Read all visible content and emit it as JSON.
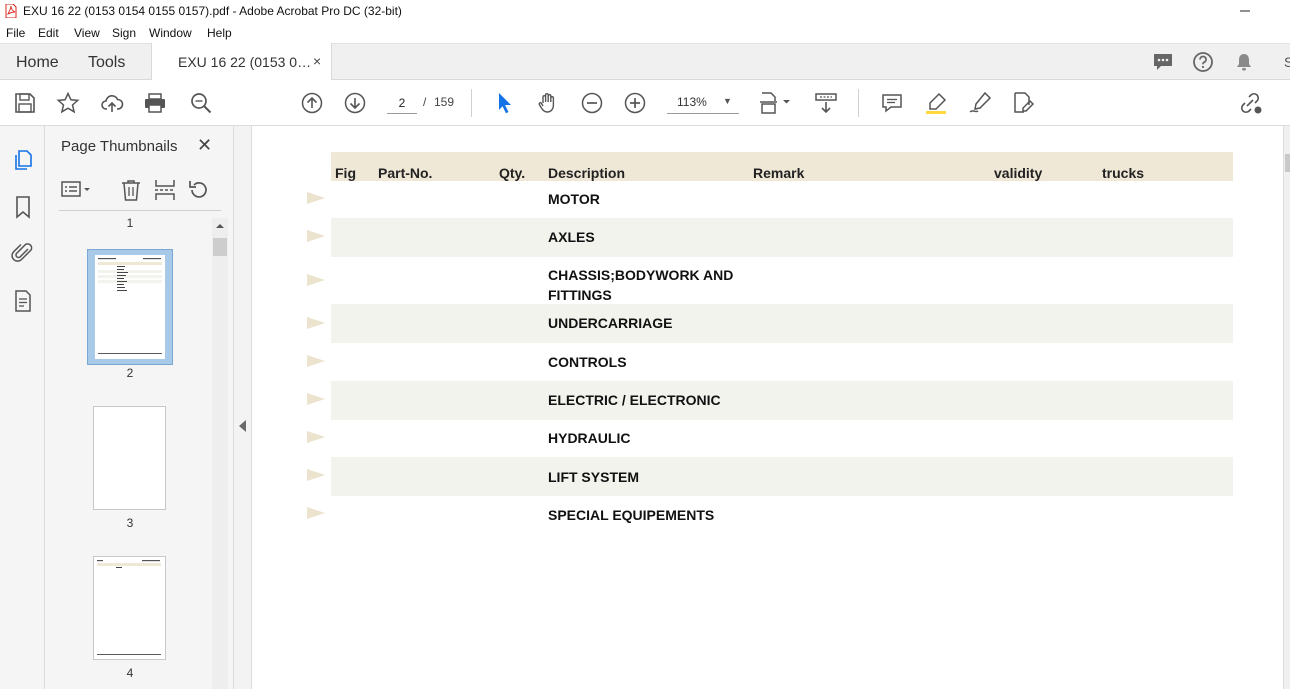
{
  "window": {
    "title": "EXU 16 22 (0153 0154 0155 0157).pdf - Adobe Acrobat Pro DC (32-bit)"
  },
  "menu": [
    "File",
    "Edit",
    "View",
    "Sign",
    "Window",
    "Help"
  ],
  "tabs": {
    "home": "Home",
    "tools": "Tools",
    "document": "EXU 16 22 (0153 0…",
    "close": "×"
  },
  "toolbar": {
    "page_current": "2",
    "page_sep": "/",
    "page_total": "159",
    "zoom": "113%"
  },
  "panel": {
    "title": "Page Thumbnails",
    "close": "✕",
    "thumbnails": [
      {
        "page": "1"
      },
      {
        "page": "2"
      },
      {
        "page": "3"
      },
      {
        "page": "4"
      }
    ]
  },
  "table": {
    "columns": [
      "Fig",
      "Part-No.",
      "Qty.",
      "Description",
      "Remark",
      "validity",
      "trucks"
    ],
    "rows": [
      {
        "description": "MOTOR"
      },
      {
        "description": "AXLES"
      },
      {
        "description": "CHASSIS;BODYWORK AND FITTINGS"
      },
      {
        "description": "UNDERCARRIAGE"
      },
      {
        "description": "CONTROLS"
      },
      {
        "description": "ELECTRIC / ELECTRONIC"
      },
      {
        "description": "HYDRAULIC"
      },
      {
        "description": "LIFT SYSTEM"
      },
      {
        "description": "SPECIAL EQUIPEMENTS"
      }
    ]
  },
  "colors": {
    "header_bg": "#f0e8d7",
    "row_shade": "#f3f3ee",
    "accent_blue": "#1473e6",
    "acrobat_red": "#d7261e"
  }
}
